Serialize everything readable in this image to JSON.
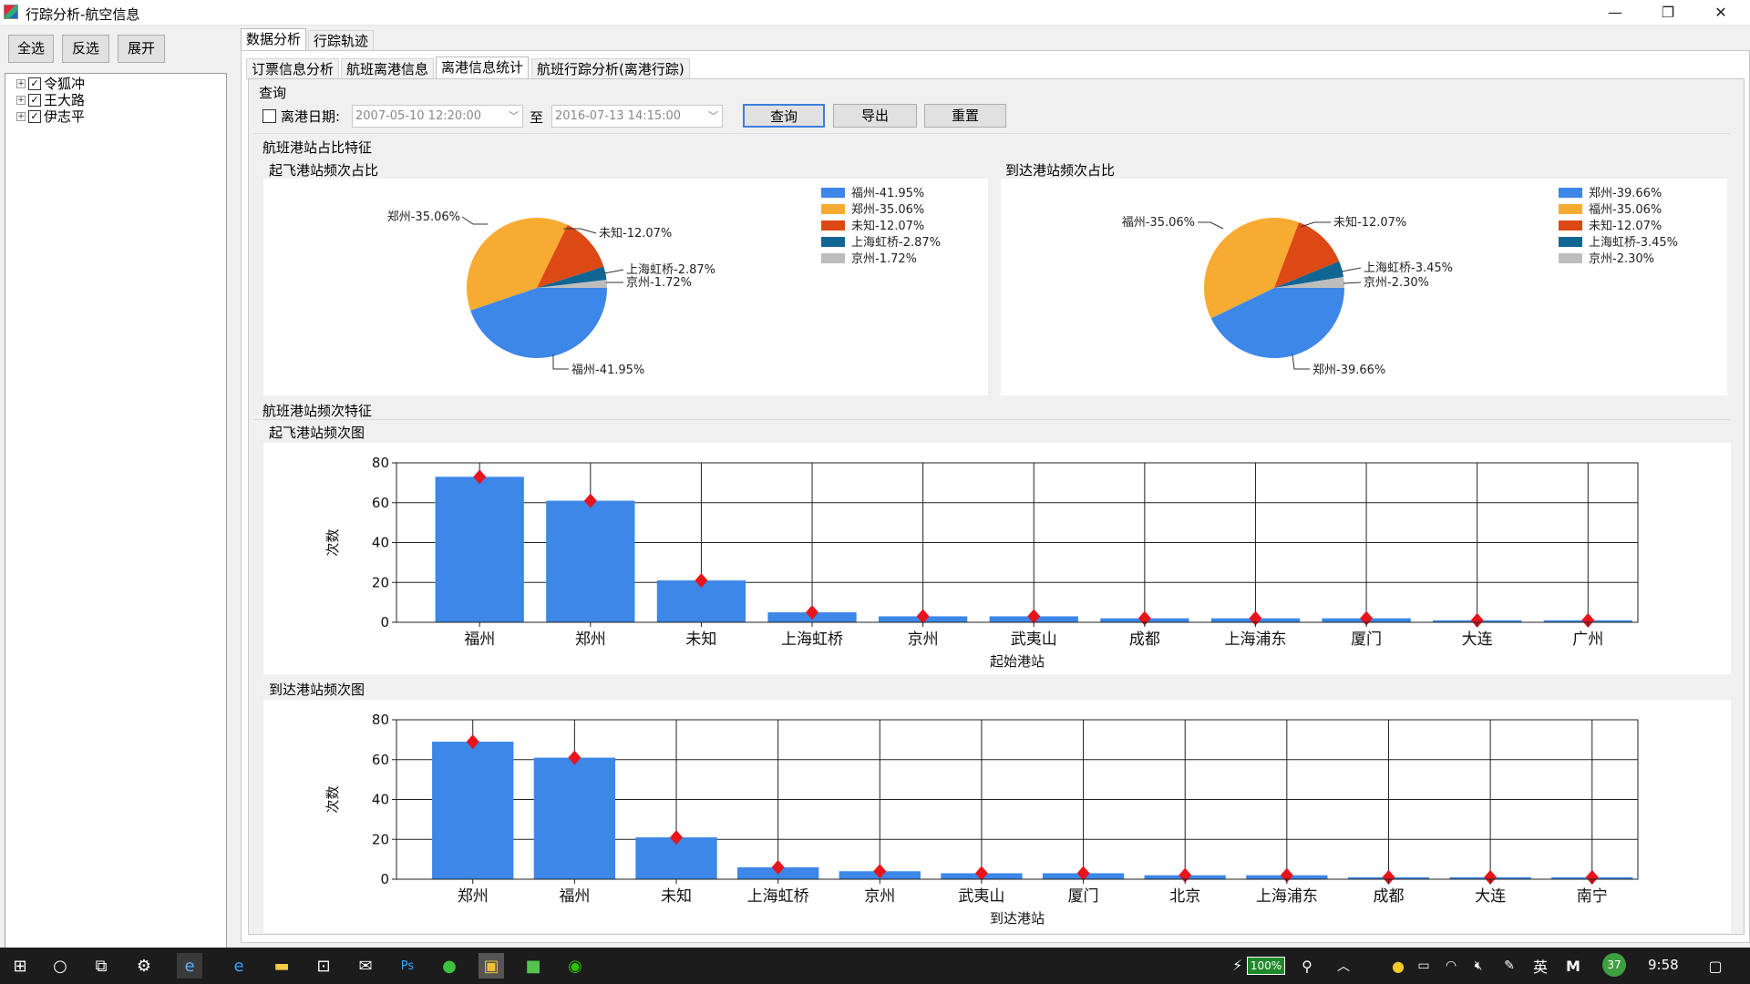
{
  "window": {
    "title": "行踪分析-航空信息",
    "minimize": "—",
    "maximize": "❐",
    "close": "✕"
  },
  "toolbar": {
    "select_all": "全选",
    "invert": "反选",
    "expand": "展开"
  },
  "tree": {
    "items": [
      {
        "label": "令狐冲",
        "checked": true
      },
      {
        "label": "王大路",
        "checked": true
      },
      {
        "label": "伊志平",
        "checked": true
      }
    ]
  },
  "main_tabs": [
    {
      "label": "数据分析",
      "active": true
    },
    {
      "label": "行踪轨迹",
      "active": false
    }
  ],
  "sub_tabs": [
    {
      "label": "订票信息分析",
      "active": false
    },
    {
      "label": "航班离港信息",
      "active": false
    },
    {
      "label": "离港信息统计",
      "active": true
    },
    {
      "label": "航班行踪分析(离港行踪)",
      "active": false
    }
  ],
  "query": {
    "group_title": "查询",
    "date_label": "离港日期:",
    "date_checked": false,
    "start_date": "2007-05-10 12:20:00",
    "to_label": "至",
    "end_date": "2016-07-13 14:15:00",
    "query_btn": "查询",
    "export_btn": "导出",
    "reset_btn": "重置"
  },
  "section_ratio": {
    "title": "航班港站占比特征"
  },
  "section_freq": {
    "title": "航班港站频次特征"
  },
  "chart_data": [
    {
      "type": "pie",
      "title": "起飞港站频次占比",
      "slices": [
        {
          "label": "福州",
          "value": 41.95,
          "text": "福州-41.95%",
          "color": "#3c87e8"
        },
        {
          "label": "郑州",
          "value": 35.06,
          "text": "郑州-35.06%",
          "color": "#f8ab32"
        },
        {
          "label": "未知",
          "value": 12.07,
          "text": "未知-12.07%",
          "color": "#dd4914"
        },
        {
          "label": "上海虹桥",
          "value": 2.87,
          "text": "上海虹桥-2.87%",
          "color": "#106593"
        },
        {
          "label": "京州",
          "value": 1.72,
          "text": "京州-1.72%",
          "color": "#bdbdbd"
        }
      ],
      "legend_position": "top-right"
    },
    {
      "type": "pie",
      "title": "到达港站频次占比",
      "slices": [
        {
          "label": "郑州",
          "value": 39.66,
          "text": "郑州-39.66%",
          "color": "#3c87e8"
        },
        {
          "label": "福州",
          "value": 35.06,
          "text": "福州-35.06%",
          "color": "#f8ab32"
        },
        {
          "label": "未知",
          "value": 12.07,
          "text": "未知-12.07%",
          "color": "#dd4914"
        },
        {
          "label": "上海虹桥",
          "value": 3.45,
          "text": "上海虹桥-3.45%",
          "color": "#106593"
        },
        {
          "label": "京州",
          "value": 2.3,
          "text": "京州-2.30%",
          "color": "#bdbdbd"
        }
      ],
      "legend_position": "top-right"
    },
    {
      "type": "bar",
      "title": "起飞港站频次图",
      "xlabel": "起始港站",
      "ylabel": "次数",
      "ylim": [
        0,
        80
      ],
      "yticks": [
        0,
        20,
        40,
        60,
        80
      ],
      "categories": [
        "福州",
        "郑州",
        "未知",
        "上海虹桥",
        "京州",
        "武夷山",
        "成都",
        "上海浦东",
        "厦门",
        "大连",
        "广州"
      ],
      "values": [
        73,
        61,
        21,
        5,
        3,
        3,
        2,
        2,
        2,
        1,
        1
      ],
      "bar_color": "#3c87e8",
      "marker_color": "#e8141c",
      "grid": true
    },
    {
      "type": "bar",
      "title": "到达港站频次图",
      "xlabel": "到达港站",
      "ylabel": "次数",
      "ylim": [
        0,
        80
      ],
      "yticks": [
        0,
        20,
        40,
        60,
        80
      ],
      "categories": [
        "郑州",
        "福州",
        "未知",
        "上海虹桥",
        "京州",
        "武夷山",
        "厦门",
        "北京",
        "上海浦东",
        "成都",
        "大连",
        "南宁"
      ],
      "values": [
        69,
        61,
        21,
        6,
        4,
        3,
        3,
        2,
        2,
        1,
        1,
        1
      ],
      "bar_color": "#3c87e8",
      "marker_color": "#e8141c",
      "grid": true
    }
  ],
  "taskbar": {
    "battery": "100%",
    "ime": "英",
    "ime2": "M",
    "badge": "37",
    "time": "9:58"
  }
}
